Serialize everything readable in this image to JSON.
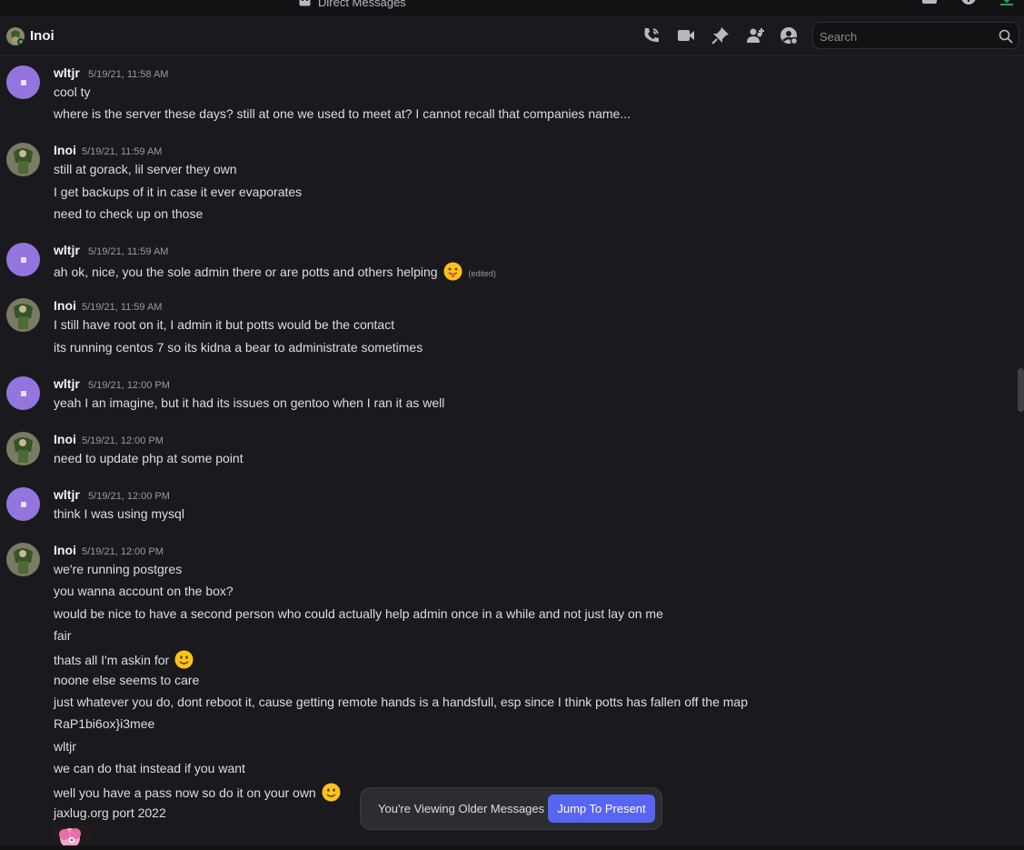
{
  "window": {
    "title": "Direct Messages"
  },
  "header": {
    "name": "Inoi"
  },
  "search": {
    "placeholder": "Search"
  },
  "colors": {
    "accent": "#5865f2",
    "purple_avatar": "#9474dd",
    "background": "#1a1a1e",
    "green_download": "#23a55a"
  },
  "messages": [
    {
      "author": "wltjr",
      "avatar": "purple",
      "time": "5/19/21, 11:58 AM",
      "lines": [
        "cool ty",
        "where is the server these days? still at one we used to meet at? I cannot recall that companies name..."
      ]
    },
    {
      "author": "Inoi",
      "avatar": "photo",
      "time": "5/19/21, 11:59 AM",
      "lines": [
        "still at gorack, lil server they own",
        "I get backups of it in case it ever evaporates",
        "need to check up on those"
      ]
    },
    {
      "author": "wltjr",
      "avatar": "purple",
      "time": "5/19/21, 11:59 AM",
      "lines": [
        "ah ok, nice, you the sole admin there or are potts and others helping"
      ],
      "edited": "(edited)",
      "emoji": "stuck-out-tongue-emoji"
    },
    {
      "author": "Inoi",
      "avatar": "photo",
      "time": "5/19/21, 11:59 AM",
      "lines": [
        "I still have root on it, I admin it but potts would be the contact",
        "its running centos 7 so its kidna  a bear to administrate sometimes"
      ]
    },
    {
      "author": "wltjr",
      "avatar": "purple",
      "time": "5/19/21, 12:00 PM",
      "lines": [
        "yeah I an imagine, but it had its issues on gentoo when I ran it as well"
      ]
    },
    {
      "author": "Inoi",
      "avatar": "photo",
      "time": "5/19/21, 12:00 PM",
      "lines": [
        "need to update php at some point"
      ]
    },
    {
      "author": "wltjr",
      "avatar": "purple",
      "time": "5/19/21, 12:00 PM",
      "lines": [
        "think I was using mysql"
      ]
    },
    {
      "author": "Inoi",
      "avatar": "photo",
      "time": "5/19/21, 12:00 PM",
      "lines": [
        "we're running postgres",
        "you wanna account on the box?",
        "would be nice to have a second person who could actually help admin once in a while and not just lay on me",
        "fair",
        "thats all I'm askin for",
        "noone else seems to care",
        "just whatever you do, dont reboot it, cause getting remote hands is a handsfull, esp since I think potts has fallen off the map",
        "RaP1bi6ox}i3mee",
        "wltjr",
        "we can do that instead if you want",
        "well you have a pass now so do it on your own",
        "jaxlug.org port 2022"
      ]
    }
  ],
  "jump": {
    "text": "You're Viewing Older Messages",
    "button": "Jump To Present"
  }
}
